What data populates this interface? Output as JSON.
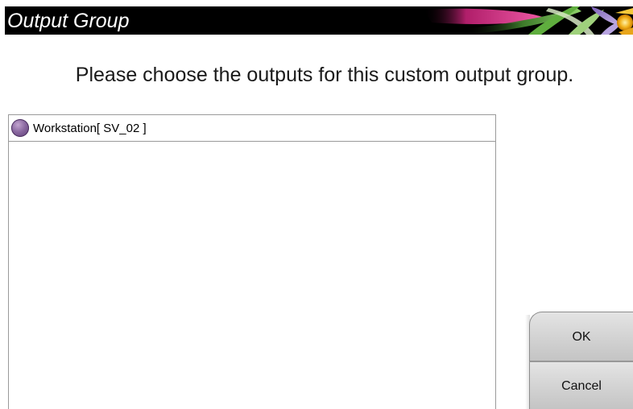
{
  "window": {
    "title": "Output Group"
  },
  "instruction": "Please choose the outputs for this custom output group.",
  "outputs": {
    "items": [
      {
        "label": "Workstation[ SV_02 ]",
        "icon": "purple-circle-icon"
      }
    ]
  },
  "buttons": {
    "ok_label": "OK",
    "cancel_label": "Cancel"
  },
  "colors": {
    "title_bar_bg": "#000000",
    "title_text": "#ffffff",
    "item_dot": "#7b5a94",
    "button_face": "#d2d2d2"
  }
}
